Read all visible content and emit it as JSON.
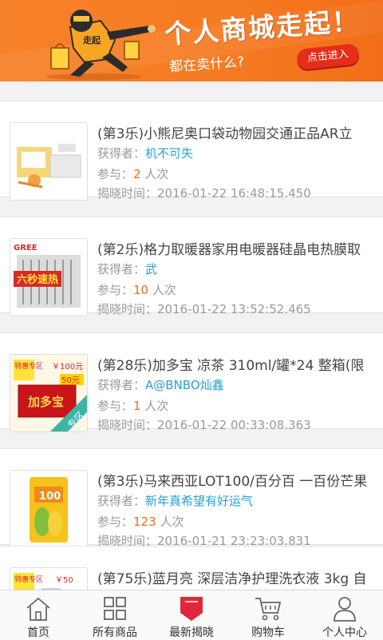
{
  "banner": {
    "headline": "个人商城走起！",
    "subtitle": "都在卖什么?",
    "cta": "点击进入",
    "bag_text": "走起"
  },
  "labels": {
    "winner": "获得者：",
    "participants": "参与：",
    "times_unit": "人次",
    "reveal_time": "揭晓时间："
  },
  "items": [
    {
      "title": "(第3乐)小熊尼奥口袋动物园交通正品AR立",
      "winner": "机不可失",
      "participants": "2",
      "time": "2016-01-22 16:48:15.450",
      "thumb_icon": "toy-box-icon"
    },
    {
      "title": "(第2乐)格力取暖器家用电暖器硅晶电热膜取",
      "winner": "武",
      "participants": "10",
      "time": "2016-01-22 13:52:52.465",
      "thumb_icon": "heater-icon",
      "thumb_brand": "GREE",
      "thumb_text": "六秒速热"
    },
    {
      "title": "(第28乐)加多宝 凉茶 310ml/罐*24  整箱(限",
      "winner": "A@BNBO灿鑫",
      "participants": "1",
      "time": "2016-01-22 00:33:08.363",
      "thumb_icon": "tea-box-icon",
      "thumb_badge": "特惠专区",
      "thumb_price": "￥100元",
      "thumb_price2": "50元",
      "thumb_brand": "加多宝",
      "thumb_corner": "专区"
    },
    {
      "title": "(第3乐)马来西亚LOT100/百分百 一百份芒果",
      "winner": "新年真希望有好运气",
      "participants": "123",
      "time": "2016-01-21 23:23:03.831",
      "thumb_icon": "mango-candy-icon",
      "thumb_brand": "100"
    },
    {
      "title": "(第75乐)蓝月亮 深层洁净护理洗衣液 3kg 自",
      "winner": "",
      "participants": "",
      "time": "",
      "thumb_icon": "detergent-icon",
      "thumb_badge": "特惠专区",
      "thumb_price": "￥50"
    }
  ],
  "nav": [
    {
      "label": "首页",
      "icon": "home-icon"
    },
    {
      "label": "所有商品",
      "icon": "grid-icon"
    },
    {
      "label": "最新揭晓",
      "icon": "pennant-icon"
    },
    {
      "label": "购物车",
      "icon": "cart-icon"
    },
    {
      "label": "个人中心",
      "icon": "user-icon"
    }
  ],
  "colors": {
    "banner": "#f57b22",
    "winner": "#2a9fd6",
    "count": "#f26b1d",
    "active_icon": "#e0283a"
  }
}
